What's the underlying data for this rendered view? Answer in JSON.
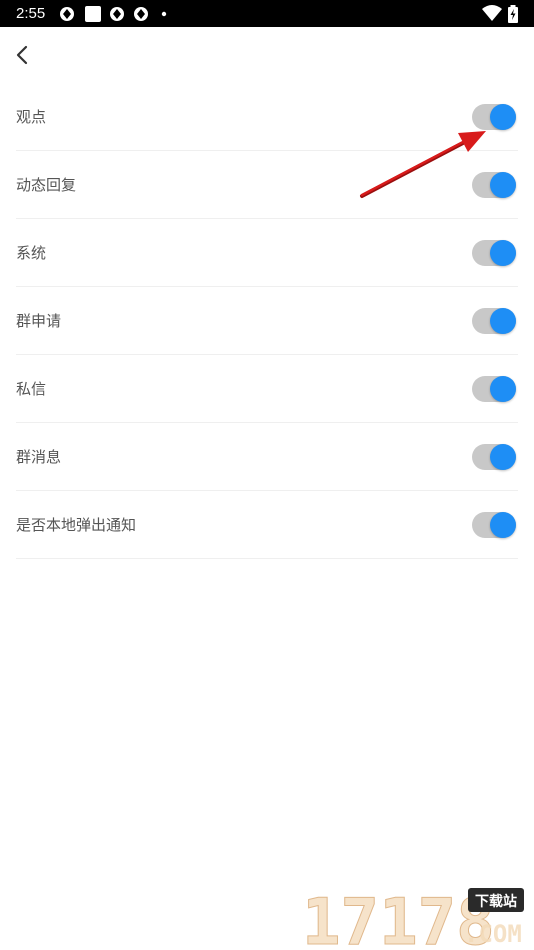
{
  "status_bar": {
    "time": "2:55",
    "icons": [
      "sync-icon",
      "square-icon",
      "sync-icon",
      "sync-icon",
      "dot-icon",
      "wifi-icon",
      "battery-charging-icon"
    ]
  },
  "header": {
    "back_icon": "chevron-left-icon"
  },
  "settings": {
    "items": [
      {
        "label": "观点",
        "enabled": true
      },
      {
        "label": "动态回复",
        "enabled": true
      },
      {
        "label": "系统",
        "enabled": true
      },
      {
        "label": "群申请",
        "enabled": true
      },
      {
        "label": "私信",
        "enabled": true
      },
      {
        "label": "群消息",
        "enabled": true
      },
      {
        "label": "是否本地弹出通知",
        "enabled": true
      }
    ]
  },
  "colors": {
    "toggle_on": "#1e8ef5",
    "toggle_track": "#c8c8c8",
    "annotation_arrow": "#d81b1b",
    "divider": "#efefef"
  },
  "watermark": {
    "number": "17178",
    "badge": "下载站",
    "domain": ".COM"
  }
}
